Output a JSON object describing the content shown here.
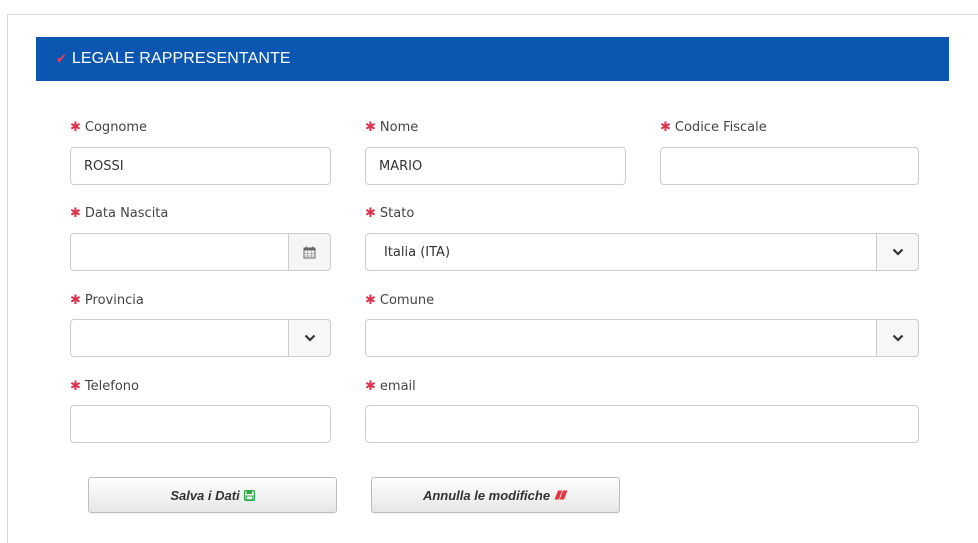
{
  "section": {
    "title": "LEGALE RAPPRESENTANTE",
    "check_icon": "check-icon",
    "header_color": "#0a56b0"
  },
  "required_mark": "✱",
  "fields": {
    "cognome": {
      "label": "Cognome",
      "value": "ROSSI"
    },
    "nome": {
      "label": "Nome",
      "value": "MARIO"
    },
    "codice_fiscale": {
      "label": "Codice Fiscale",
      "value": ""
    },
    "data_nascita": {
      "label": "Data Nascita",
      "value": "",
      "icon": "calendar-icon"
    },
    "stato": {
      "label": "Stato",
      "value": "Italia (ITA)",
      "icon": "chevron-down-icon"
    },
    "provincia": {
      "label": "Provincia",
      "value": "",
      "icon": "chevron-down-icon"
    },
    "comune": {
      "label": "Comune",
      "value": "",
      "icon": "chevron-down-icon"
    },
    "telefono": {
      "label": "Telefono",
      "value": ""
    },
    "email": {
      "label": "email",
      "value": ""
    }
  },
  "buttons": {
    "save": {
      "label": "Salva i Dati",
      "icon": "floppy-disk-icon",
      "icon_color": "#2aa845"
    },
    "cancel": {
      "label": "Annulla le modifiche",
      "icon": "eraser-icon",
      "icon_color": "#e0343f"
    }
  }
}
